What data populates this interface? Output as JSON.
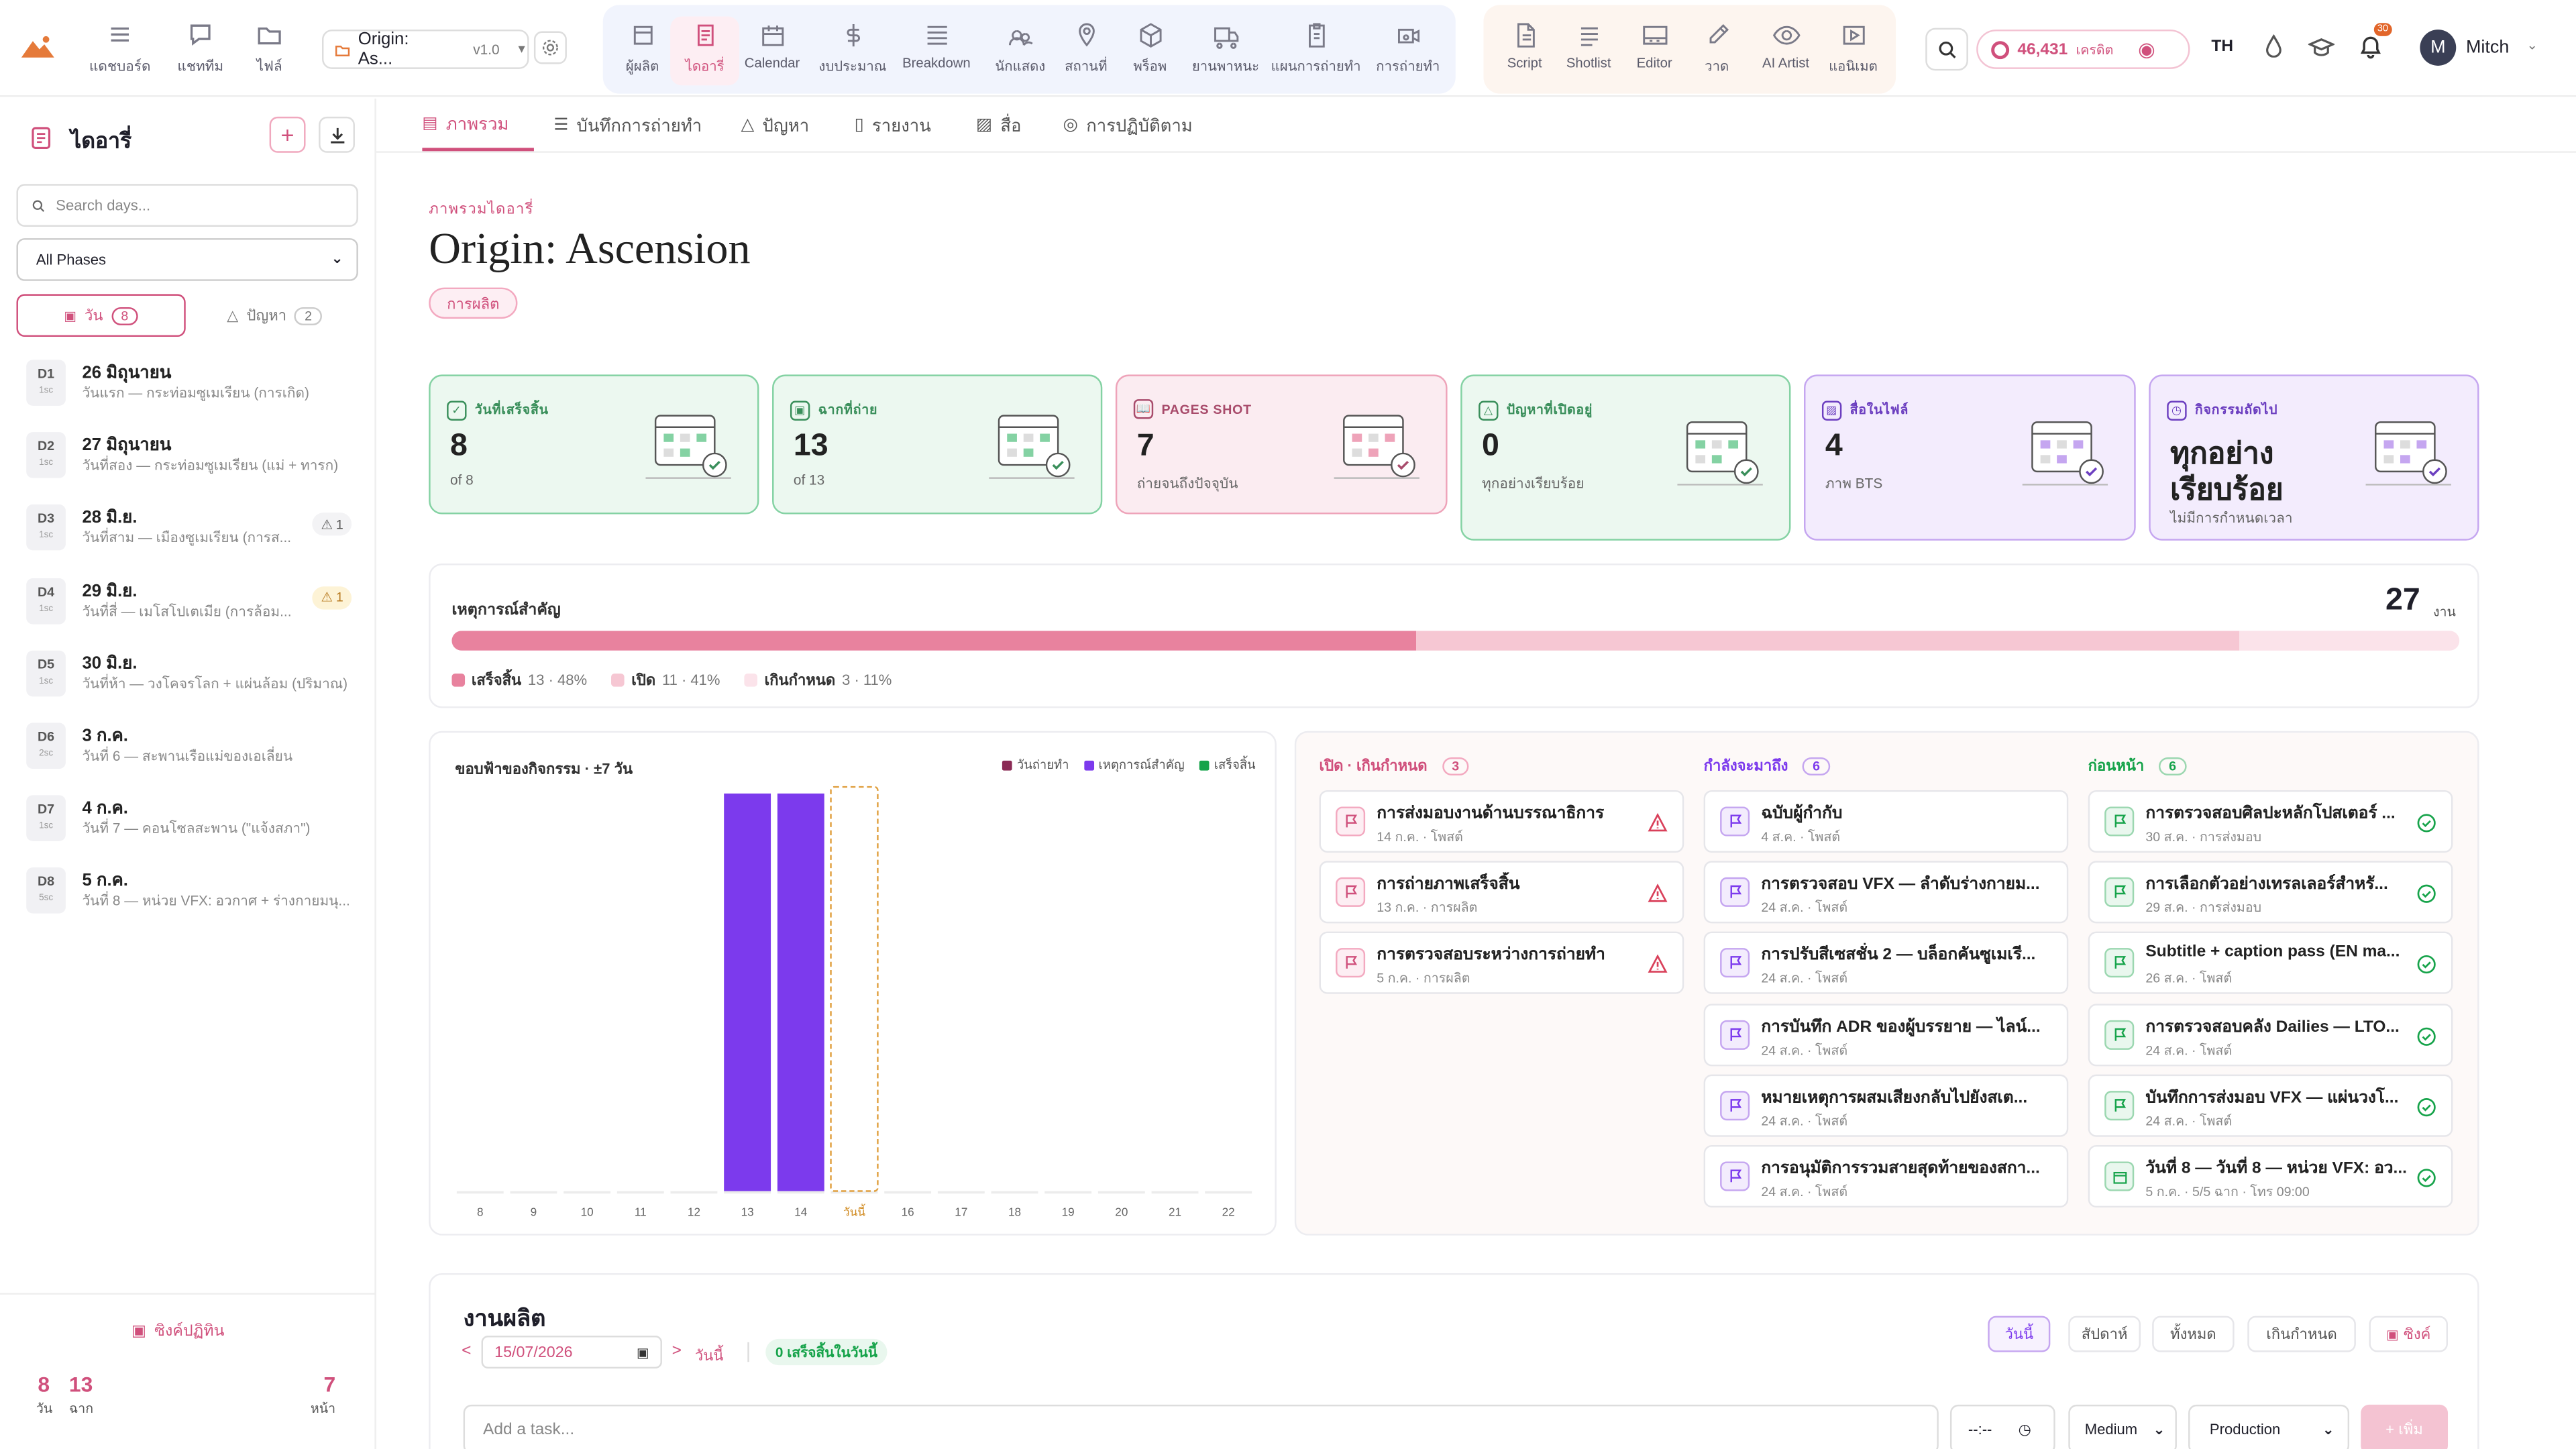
{
  "nav": {
    "left": [
      {
        "label": "แดชบอร์ด"
      },
      {
        "label": "แชททีม"
      },
      {
        "label": "ไฟล์"
      }
    ],
    "project": {
      "name": "Origin: As...",
      "version": "v1.0"
    },
    "tools": [
      {
        "label": "ผู้ผลิต"
      },
      {
        "label": "ไดอารี่"
      },
      {
        "label": "Calendar"
      },
      {
        "label": "งบประมาณ"
      },
      {
        "label": "Breakdown"
      },
      {
        "label": "นักแสดง"
      },
      {
        "label": "สถานที่"
      },
      {
        "label": "พร็อพ"
      },
      {
        "label": "ยานพาหนะ"
      },
      {
        "label": "แผนการถ่ายทำ"
      },
      {
        "label": "การถ่ายทำ"
      }
    ],
    "creative": [
      {
        "label": "Script"
      },
      {
        "label": "Shotlist"
      },
      {
        "label": "Editor"
      },
      {
        "label": "วาด"
      },
      {
        "label": "AI Artist"
      },
      {
        "label": "แอนิเมต"
      }
    ],
    "credits": "46,431",
    "credits_unit": "เครดิต",
    "lang": "TH",
    "notif_count": "30",
    "user_initial": "M",
    "user_name": "Mitch"
  },
  "sidebar": {
    "title": "ไดอารี่",
    "search_placeholder": "Search days...",
    "phase_select": "All Phases",
    "tab_days": "วัน",
    "tab_days_count": "8",
    "tab_issues": "ปัญหา",
    "tab_issues_count": "2",
    "days": [
      {
        "code": "D1",
        "sc": "1sc",
        "title": "26 มิถุนายน",
        "sub": "วันแรก — กระท่อมซูเมเรียน (การเกิด)",
        "warn": ""
      },
      {
        "code": "D2",
        "sc": "1sc",
        "title": "27 มิถุนายน",
        "sub": "วันที่สอง — กระท่อมซูเมเรียน (แม่ + ทารก)",
        "warn": ""
      },
      {
        "code": "D3",
        "sc": "1sc",
        "title": "28 มิ.ย.",
        "sub": "วันที่สาม — เมืองซูเมเรียน (การส...",
        "warn": "1"
      },
      {
        "code": "D4",
        "sc": "1sc",
        "title": "29 มิ.ย.",
        "sub": "วันที่สี่ — เมโสโปเตเมีย (การล้อม...",
        "warn": "1"
      },
      {
        "code": "D5",
        "sc": "1sc",
        "title": "30 มิ.ย.",
        "sub": "วันที่ห้า — วงโคจรโลก + แผ่นล้อม (ปริมาณ)",
        "warn": ""
      },
      {
        "code": "D6",
        "sc": "2sc",
        "title": "3 ก.ค.",
        "sub": "วันที่ 6 — สะพานเรือแม่ของเอเลี่ยน",
        "warn": ""
      },
      {
        "code": "D7",
        "sc": "1sc",
        "title": "4 ก.ค.",
        "sub": "วันที่ 7 — คอนโซลสะพาน (\"แจ้งสภา\")",
        "warn": ""
      },
      {
        "code": "D8",
        "sc": "5sc",
        "title": "5 ก.ค.",
        "sub": "วันที่ 8 — หน่วย VFX: อวกาศ + ร่างกายมนุ...",
        "warn": ""
      }
    ],
    "sync_label": "ซิงค์ปฏิทิน",
    "footer": {
      "days": "8",
      "days_label": "วัน",
      "scenes": "13",
      "scenes_label": "ฉาก",
      "pages": "7",
      "pages_label": "หน้า"
    }
  },
  "tabs": [
    "ภาพรวม",
    "บันทึกการถ่ายทำ",
    "ปัญหา",
    "รายงาน",
    "สื่อ",
    "การปฏิบัติตาม"
  ],
  "header": {
    "eyebrow": "ภาพรวมไดอารี่",
    "title": "Origin: Ascension",
    "phase_badge": "การผลิต"
  },
  "stats": [
    {
      "label": "วันที่เสร็จสิ้น",
      "value": "8",
      "sub": "of 8"
    },
    {
      "label": "ฉากที่ถ่าย",
      "value": "13",
      "sub": "of 13"
    },
    {
      "label": "PAGES SHOT",
      "value": "7",
      "sub": "ถ่ายจนถึงปัจจุบัน"
    },
    {
      "label": "ปัญหาที่เปิดอยู่",
      "value": "0",
      "sub": "ทุกอย่างเรียบร้อย"
    },
    {
      "label": "สื่อในไฟล์",
      "value": "4",
      "sub": "ภาพ BTS"
    },
    {
      "label": "กิจกรรมถัดไป",
      "value_line1": "ทุกอย่าง",
      "value_line2": "เรียบร้อย",
      "sub": "ไม่มีการกำหนดเวลา"
    }
  ],
  "milestones": {
    "title": "เหตุการณ์สำคัญ",
    "total": "27",
    "total_unit": "งาน",
    "done_frac": 0.48,
    "open_frac": 0.41,
    "overdue_frac": 0.11,
    "legend": [
      {
        "label": "เสร็จสิ้น",
        "detail": "13 · 48%",
        "color": "#e8829e"
      },
      {
        "label": "เปิด",
        "detail": "11 · 41%",
        "color": "#f6c7d3"
      },
      {
        "label": "เกินกำหนด",
        "detail": "3 · 11%",
        "color": "#fbe3ea"
      }
    ]
  },
  "chart_data": {
    "type": "bar",
    "title": "ขอบฟ้าของกิจกรรม · ±7 วัน",
    "categories": [
      "8",
      "9",
      "10",
      "11",
      "12",
      "13",
      "14",
      "วันนี้",
      "16",
      "17",
      "18",
      "19",
      "20",
      "21",
      "22"
    ],
    "series": [
      {
        "name": "วันถ่ายทำ",
        "color": "#8b2a55",
        "values": [
          0,
          0,
          0,
          0,
          0,
          0,
          0,
          0,
          0,
          0,
          0,
          0,
          0,
          0,
          0
        ]
      },
      {
        "name": "เหตุการณ์สำคัญ",
        "color": "#7c3aed",
        "values": [
          0,
          0,
          0,
          0,
          0,
          1,
          1,
          0,
          0,
          0,
          0,
          0,
          0,
          0,
          0
        ]
      },
      {
        "name": "เสร็จสิ้น",
        "color": "#16a34a",
        "values": [
          0,
          0,
          0,
          0,
          0,
          0,
          0,
          0,
          0,
          0,
          0,
          0,
          0,
          0,
          0
        ]
      }
    ],
    "today_index": 7
  },
  "columns": [
    {
      "title": "เปิด · เกินกำหนด",
      "count": "3",
      "items": [
        {
          "t": "การส่งมอบงานด้านบรรณาธิการ",
          "s": "14 ก.ค. · โพสต์"
        },
        {
          "t": "การถ่ายภาพเสร็จสิ้น",
          "s": "13 ก.ค. · การผลิต"
        },
        {
          "t": "การตรวจสอบระหว่างการถ่ายทำ",
          "s": "5 ก.ค. · การผลิต"
        }
      ]
    },
    {
      "title": "กำลังจะมาถึง",
      "count": "6",
      "items": [
        {
          "t": "ฉบับผู้กำกับ",
          "s": "4 ส.ค. · โพสต์"
        },
        {
          "t": "การตรวจสอบ VFX — ลำดับร่างกายม...",
          "s": "24 ส.ค. · โพสต์"
        },
        {
          "t": "การปรับสีเซสชั่น 2 — บล็อกคันซูเมเรี...",
          "s": "24 ส.ค. · โพสต์"
        },
        {
          "t": "การบันทึก ADR ของผู้บรรยาย — ไลน์...",
          "s": "24 ส.ค. · โพสต์"
        },
        {
          "t": "หมายเหตุการผสมเสียงกลับไปยังสเต...",
          "s": "24 ส.ค. · โพสต์"
        },
        {
          "t": "การอนุมัติการรวมสายสุดท้ายของสกา...",
          "s": "24 ส.ค. · โพสต์"
        }
      ]
    },
    {
      "title": "ก่อนหน้า",
      "count": "6",
      "items": [
        {
          "t": "การตรวจสอบศิลปะหลักโปสเตอร์ ...",
          "s": "30 ส.ค. · การส่งมอบ"
        },
        {
          "t": "การเลือกตัวอย่างเทรลเลอร์สำหรั...",
          "s": "29 ส.ค. · การส่งมอบ"
        },
        {
          "t": "Subtitle + caption pass (EN ma...",
          "s": "26 ส.ค. · โพสต์"
        },
        {
          "t": "การตรวจสอบคลัง Dailies — LTO...",
          "s": "24 ส.ค. · โพสต์"
        },
        {
          "t": "บันทึกการส่งมอบ VFX — แผ่นวงโ...",
          "s": "24 ส.ค. · โพสต์"
        },
        {
          "t": "วันที่ 8 — วันที่ 8 — หน่วย VFX: อว...",
          "s": "5 ก.ค. · 5/5 ฉาก · โทร 09:00"
        }
      ]
    }
  ],
  "tasks": {
    "title": "งานผลิต",
    "date": "15/07/2026",
    "today_link": "วันนี้",
    "done_badge": "0 เสร็จสิ้นในวันนี้",
    "filters": [
      "วันนี้",
      "สัปดาห์",
      "ทั้งหมด",
      "เกินกำหนด",
      "ซิงค์"
    ],
    "add_placeholder": "Add a task...",
    "time_placeholder": "--:--",
    "priority": "Medium",
    "category": "Production",
    "add_btn": "+ เพิ่ม"
  }
}
